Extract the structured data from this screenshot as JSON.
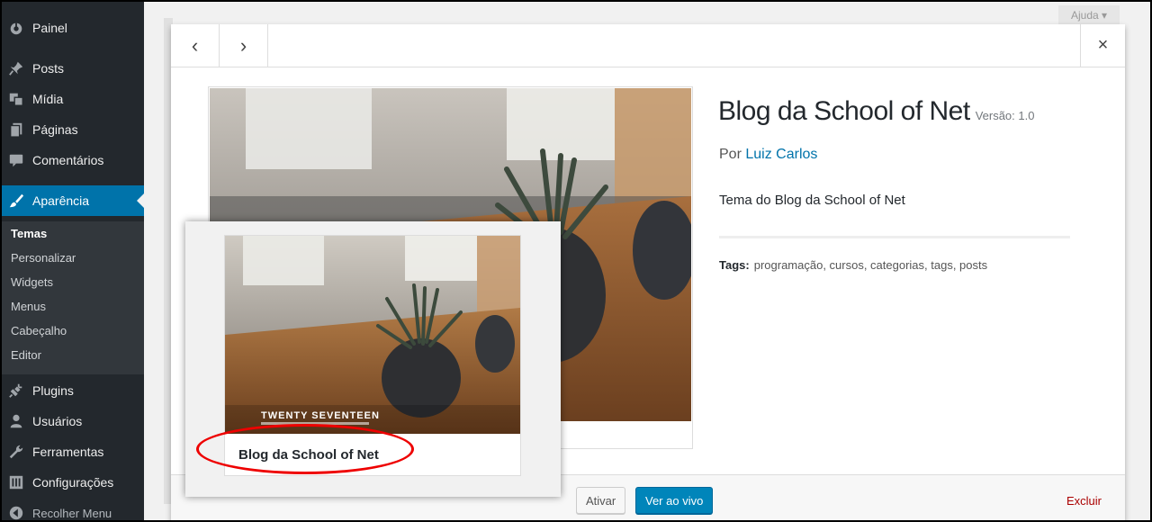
{
  "sidebar": {
    "items": [
      {
        "label": "Painel",
        "icon": "dashboard-icon"
      },
      {
        "label": "Posts",
        "icon": "pin-icon"
      },
      {
        "label": "Mídia",
        "icon": "media-icon"
      },
      {
        "label": "Páginas",
        "icon": "pages-icon"
      },
      {
        "label": "Comentários",
        "icon": "comments-icon"
      },
      {
        "label": "Aparência",
        "icon": "paintbrush-icon"
      },
      {
        "label": "Plugins",
        "icon": "plug-icon"
      },
      {
        "label": "Usuários",
        "icon": "users-icon"
      },
      {
        "label": "Ferramentas",
        "icon": "wrench-icon"
      },
      {
        "label": "Configurações",
        "icon": "settings-icon"
      },
      {
        "label": "Recolher Menu",
        "icon": "collapse-icon"
      }
    ],
    "submenu": [
      "Temas",
      "Personalizar",
      "Widgets",
      "Menus",
      "Cabeçalho",
      "Editor"
    ],
    "active_item": "Aparência",
    "current_sub": "Temas"
  },
  "background": {
    "help_label": "Ajuda ▾"
  },
  "modal": {
    "prev_glyph": "‹",
    "next_glyph": "›",
    "close_glyph": "×",
    "theme_name": "Blog da School of Net",
    "version": "Versão: 1.0",
    "author_prefix": "Por",
    "author_name": "Luiz Carlos",
    "description": "Tema do Blog da School of Net",
    "tags_label": "Tags:",
    "tags": "programação, cursos, categorias, tags, posts",
    "scroll_glyph": "↓",
    "footer": {
      "activate": "Ativar",
      "live_preview": "Ver ao vivo",
      "delete": "Excluir"
    }
  },
  "popup": {
    "card_name": "Blog da School of Net",
    "screenshot_title": "TWENTY SEVENTEEN"
  },
  "colors": {
    "sidebar_bg": "#23282d",
    "accent": "#0073aa",
    "primary_button": "#0085ba",
    "delete": "#aa0000",
    "highlight_ellipse": "#ee0000"
  }
}
